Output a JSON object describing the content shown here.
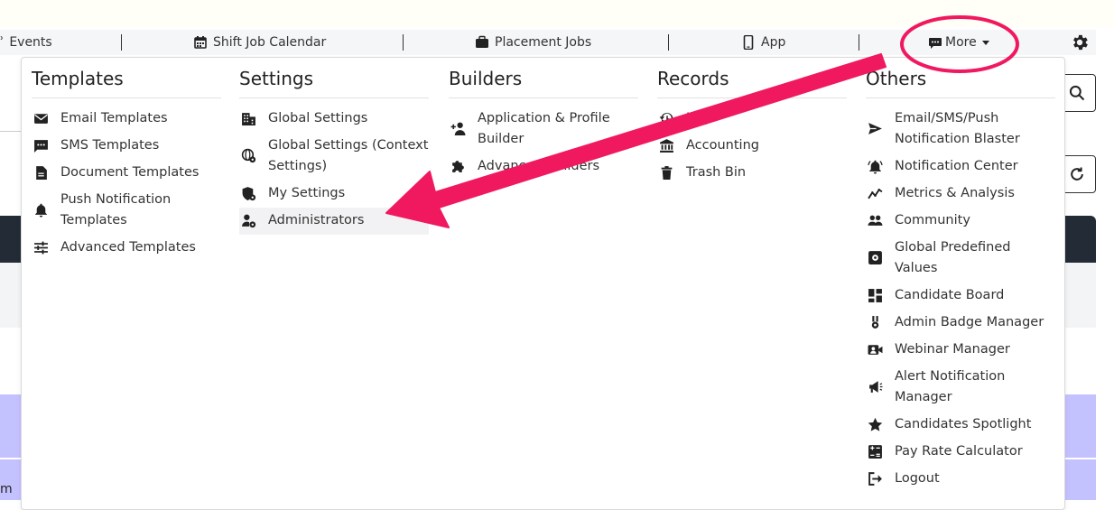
{
  "nav": {
    "events": "Events",
    "shift_job_calendar": "Shift Job Calendar",
    "placement_jobs": "Placement Jobs",
    "app": "App",
    "more": "More"
  },
  "background": {
    "partial_text": "m"
  },
  "menu": {
    "templates": {
      "title": "Templates",
      "items": [
        {
          "label": "Email Templates",
          "icon": "envelope-icon"
        },
        {
          "label": "SMS Templates",
          "icon": "sms-icon"
        },
        {
          "label": "Document Templates",
          "icon": "document-icon"
        },
        {
          "label": "Push Notification Templates",
          "icon": "bell-icon"
        },
        {
          "label": "Advanced Templates",
          "icon": "sliders-icon"
        }
      ]
    },
    "settings": {
      "title": "Settings",
      "items": [
        {
          "label": "Global Settings",
          "icon": "building-icon"
        },
        {
          "label": "Global Settings (Context Settings)",
          "icon": "globe-gear-icon"
        },
        {
          "label": "My Settings",
          "icon": "shield-gear-icon"
        },
        {
          "label": "Administrators",
          "icon": "user-gear-icon"
        }
      ]
    },
    "builders": {
      "title": "Builders",
      "items": [
        {
          "label": "Application & Profile Builder",
          "icon": "user-plus-icon"
        },
        {
          "label": "Advanced Builders",
          "icon": "puzzle-icon"
        }
      ]
    },
    "records": {
      "title": "Records",
      "items": [
        {
          "label": "Logs",
          "icon": "history-icon"
        },
        {
          "label": "Accounting",
          "icon": "bank-icon"
        },
        {
          "label": "Trash Bin",
          "icon": "trash-icon"
        }
      ]
    },
    "others": {
      "title": "Others",
      "items": [
        {
          "label": "Email/SMS/Push Notification Blaster",
          "icon": "send-icon"
        },
        {
          "label": "Notification Center",
          "icon": "bell-ring-icon"
        },
        {
          "label": "Metrics & Analysis",
          "icon": "chart-line-icon"
        },
        {
          "label": "Community",
          "icon": "people-icon"
        },
        {
          "label": "Global Predefined Values",
          "icon": "settings-box-icon"
        },
        {
          "label": "Candidate Board",
          "icon": "dashboard-icon"
        },
        {
          "label": "Admin Badge Manager",
          "icon": "badge-icon"
        },
        {
          "label": "Webinar Manager",
          "icon": "video-person-icon"
        },
        {
          "label": "Alert Notification Manager",
          "icon": "megaphone-icon"
        },
        {
          "label": "Candidates Spotlight",
          "icon": "star-icon"
        },
        {
          "label": "Pay Rate Calculator",
          "icon": "calculator-icon"
        },
        {
          "label": "Logout",
          "icon": "logout-icon"
        }
      ]
    }
  },
  "colors": {
    "annotation": "#f0195f",
    "dark_bar": "#232b36",
    "purple_row": "#c4c1ff"
  }
}
